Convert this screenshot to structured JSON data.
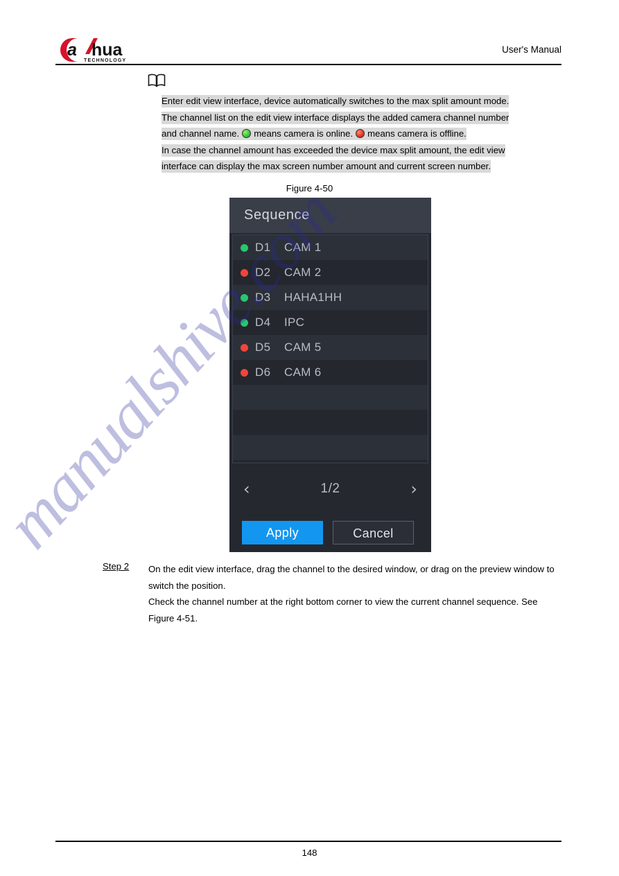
{
  "header": {
    "logo_text": "alhua",
    "logo_sub": "TECHNOLOGY",
    "title": "User's Manual"
  },
  "note": {
    "icon": "book-icon",
    "lines": [
      "Enter edit view interface, device automatically switches to the max split amount mode.",
      "The channel list on the edit view interface displays the added camera channel number"
    ],
    "line3_part1": "and channel name.",
    "line3_part2": "means camera is online.",
    "line3_part3": "means camera is offline.",
    "lines_tail": [
      "In case the channel amount has exceeded the device max split amount, the edit view",
      "interface can display the max screen number amount and current screen number."
    ]
  },
  "figure": {
    "caption": "Figure 4-50"
  },
  "dialog": {
    "title": "Sequence",
    "channels": [
      {
        "status": "online",
        "id": "D1",
        "name": "CAM 1"
      },
      {
        "status": "offline",
        "id": "D2",
        "name": "CAM 2"
      },
      {
        "status": "online",
        "id": "D3",
        "name": "HAHA1HH"
      },
      {
        "status": "online",
        "id": "D4",
        "name": "IPC"
      },
      {
        "status": "offline",
        "id": "D5",
        "name": "CAM 5"
      },
      {
        "status": "offline",
        "id": "D6",
        "name": "CAM 6"
      }
    ],
    "pager": {
      "prev_icon": "‹",
      "label": "1/2",
      "next_icon": "›"
    },
    "buttons": {
      "apply": "Apply",
      "cancel": "Cancel"
    },
    "colors": {
      "accent": "#1296f0",
      "online": "#28c76f",
      "offline": "#f0453a",
      "title_bar": "#3a3e48",
      "body": "#25282f"
    }
  },
  "step": {
    "label": "Step 2",
    "paragraph1": "On the edit view interface, drag the channel to the desired window, or drag on the preview window to switch the position.",
    "paragraph2": "Check the channel number at the right bottom corner to view the current channel sequence. See Figure 4-51."
  },
  "footer": {
    "page_number": "148"
  },
  "watermark": {
    "text": "manualshive.com"
  }
}
